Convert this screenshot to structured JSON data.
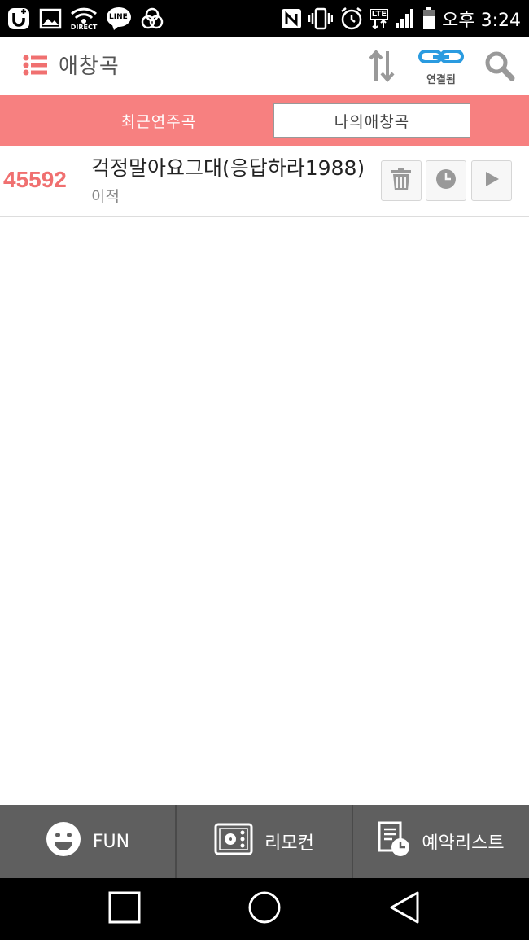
{
  "status_bar": {
    "time": "오후 3:24",
    "left_icons": [
      "uplus-icon",
      "image-icon",
      "wifi-direct-icon",
      "line-icon",
      "circles-icon"
    ],
    "wifi_direct_label": "DIRECT",
    "line_label": "LINE",
    "right_icons": [
      "nfc-icon",
      "vibrate-icon",
      "alarm-icon",
      "lte-icon",
      "signal-icon",
      "battery-icon"
    ],
    "lte_label": "LTE"
  },
  "app_bar": {
    "title": "애창곡",
    "connection_label": "연결됨",
    "colors": {
      "accent": "#f78080",
      "link": "#2a9be0"
    }
  },
  "tabs": [
    {
      "label": "최근연주곡",
      "selected": false
    },
    {
      "label": "나의애창곡",
      "selected": true
    }
  ],
  "songs": [
    {
      "number": "45592",
      "title": "걱정말아요그대(응답하라1988)",
      "artist": "이적"
    }
  ],
  "bottom_nav": [
    {
      "label": "FUN",
      "icon": "smiley-icon"
    },
    {
      "label": "리모컨",
      "icon": "remote-icon"
    },
    {
      "label": "예약리스트",
      "icon": "reservation-list-icon"
    }
  ],
  "system_nav": [
    "recents-icon",
    "home-icon",
    "back-icon"
  ]
}
